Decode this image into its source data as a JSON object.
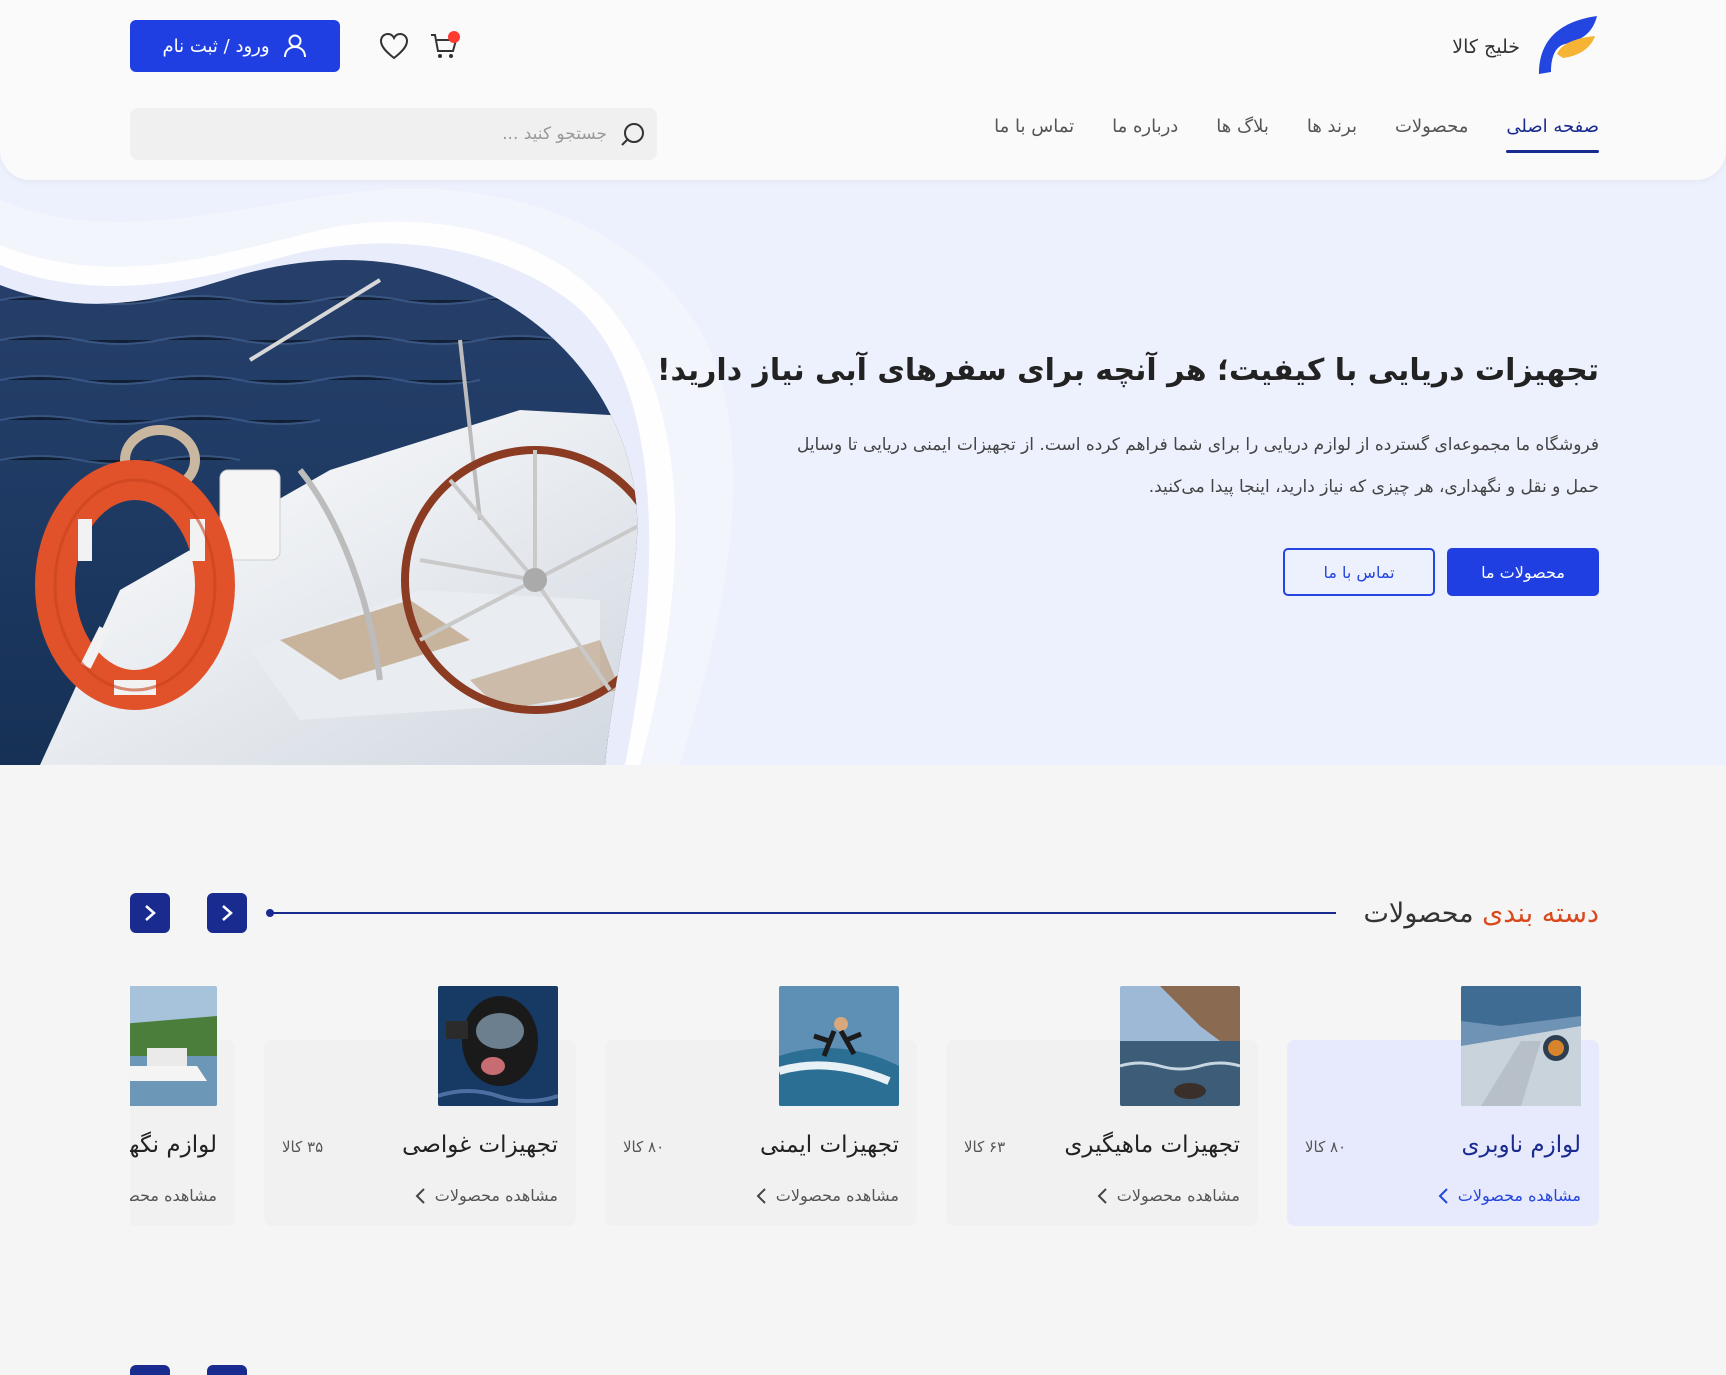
{
  "header": {
    "brand_name": "خلیج کالا",
    "login_label": "ورود / ثبت نام",
    "cart_has_badge": true,
    "nav": [
      {
        "label": "صفحه اصلی",
        "active": true
      },
      {
        "label": "محصولات"
      },
      {
        "label": "برند ها"
      },
      {
        "label": "بلاگ ها"
      },
      {
        "label": "درباره ما"
      },
      {
        "label": "تماس با ما"
      }
    ],
    "search_placeholder": "جستجو کنید ..."
  },
  "hero": {
    "title": "تجهیزات دریایی با کیفیت؛ هر آنچه برای سفرهای آبی نیاز دارید!",
    "description": "فروشگاه ما مجموعه‌ای گسترده از لوازم دریایی را برای شما فراهم کرده است. از تجهیزات ایمنی دریایی تا وسایل حمل و نقل و نگهداری، هر چیزی که نیاز دارید، اینجا پیدا می‌کنید.",
    "primary_button": "محصولات ما",
    "secondary_button": "تماس با ما"
  },
  "categories": {
    "title_accent": "دسته بندی",
    "title_rest": " محصولات",
    "items": [
      {
        "name": "لوازم ناوبری",
        "count": "۸۰ کالا",
        "link": "مشاهده محصولات",
        "active": true
      },
      {
        "name": "تجهیزات ماهیگیری",
        "count": "۶۳ کالا",
        "link": "مشاهده محصولات"
      },
      {
        "name": "تجهیزات ایمنی",
        "count": "۸۰ کالا",
        "link": "مشاهده محصولات"
      },
      {
        "name": "تجهیزات غواصی",
        "count": "۳۵ کالا",
        "link": "مشاهده محصولات"
      },
      {
        "name": "لوازم نگهداری",
        "count": "",
        "link": "مشاهده محصولات"
      }
    ]
  },
  "colors": {
    "primary": "#1f3fe3",
    "navy": "#1a2b8f",
    "accent": "#d9491c",
    "hero_bg": "#edf0fd"
  }
}
